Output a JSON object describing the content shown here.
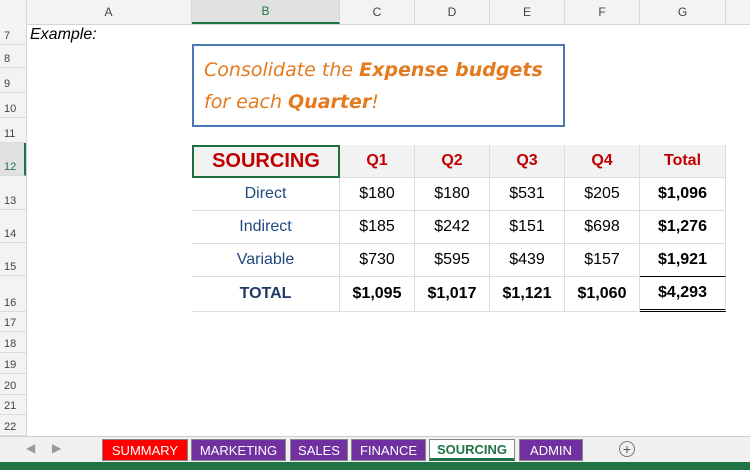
{
  "columns": [
    "A",
    "B",
    "C",
    "D",
    "E",
    "F",
    "G"
  ],
  "selected_column": "B",
  "rows": [
    "7",
    "8",
    "9",
    "10",
    "11",
    "12",
    "13",
    "14",
    "15",
    "16",
    "17",
    "18",
    "19",
    "20",
    "21",
    "22"
  ],
  "selected_row": "12",
  "example_label": "Example:",
  "callout": {
    "part1": "Consolidate the ",
    "bold1": "Expense budgets",
    "part2": " for each ",
    "bold2": "Quarter",
    "part3": "!"
  },
  "table": {
    "header": [
      "SOURCING",
      "Q1",
      "Q2",
      "Q3",
      "Q4",
      "Total"
    ],
    "rows": [
      {
        "label": "Direct",
        "values": [
          "$180",
          "$180",
          "$531",
          "$205"
        ],
        "total": "$1,096"
      },
      {
        "label": "Indirect",
        "values": [
          "$185",
          "$242",
          "$151",
          "$698"
        ],
        "total": "$1,276"
      },
      {
        "label": "Variable",
        "values": [
          "$730",
          "$595",
          "$439",
          "$157"
        ],
        "total": "$1,921"
      }
    ],
    "total_row": {
      "label": "TOTAL",
      "values": [
        "$1,095",
        "$1,017",
        "$1,121",
        "$1,060"
      ],
      "total": "$4,293"
    }
  },
  "sheet_tabs": [
    {
      "label": "SUMMARY",
      "color": "#ff0000"
    },
    {
      "label": "MARKETING",
      "color": "#7030a0"
    },
    {
      "label": "SALES",
      "color": "#7030a0"
    },
    {
      "label": "FINANCE",
      "color": "#7030a0"
    },
    {
      "label": "SOURCING",
      "color": "#217346",
      "active": true
    },
    {
      "label": "ADMIN",
      "color": "#7030a0"
    }
  ],
  "icons": {
    "prev": "chevron-left-icon",
    "next": "chevron-right-icon",
    "add_sheet": "plus-circle-icon"
  }
}
